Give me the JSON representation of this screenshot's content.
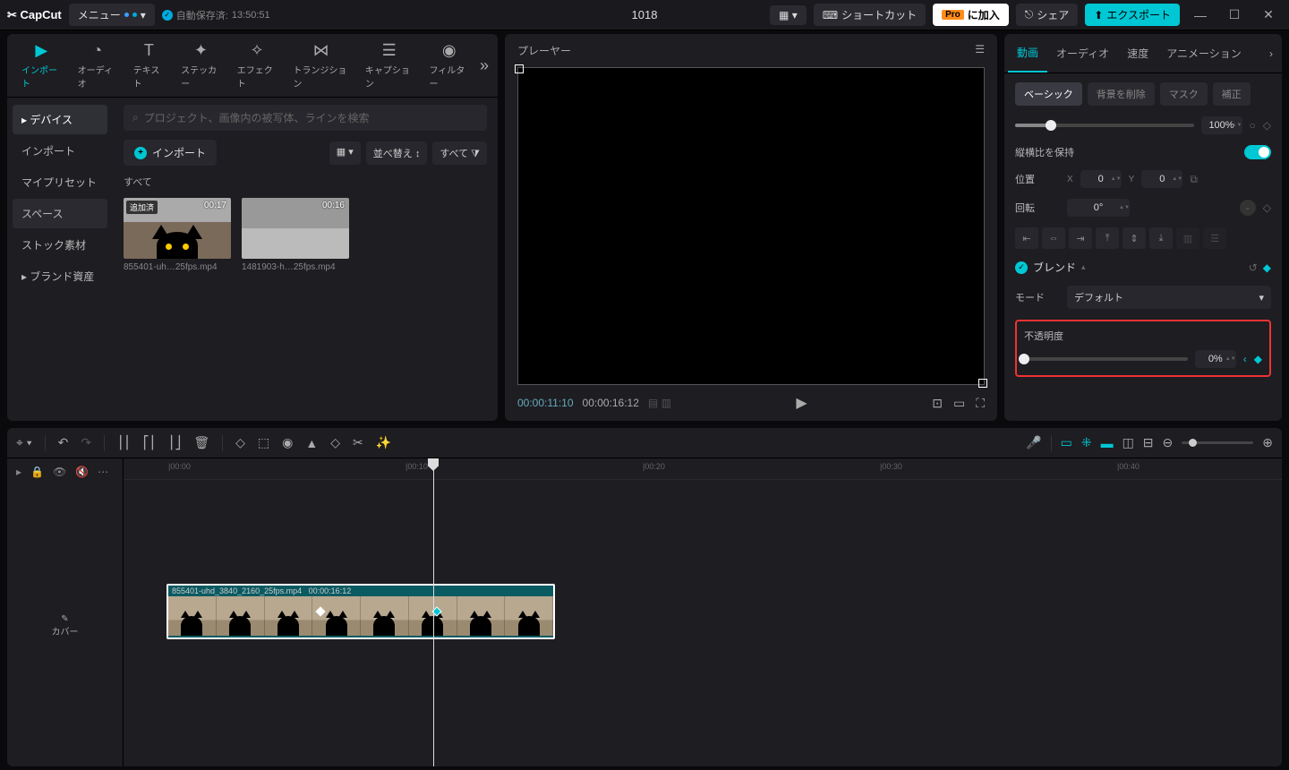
{
  "app": {
    "name": "CapCut"
  },
  "titlebar": {
    "menu": "メニュー",
    "autosave_label": "自動保存済:",
    "autosave_time": "13:50:51",
    "project_title": "1018",
    "shortcut": "ショートカット",
    "pro_badge": "Pro",
    "pro_label": "に加入",
    "share": "シェア",
    "export": "エクスポート"
  },
  "media_tabs": {
    "import": "インポート",
    "audio": "オーディオ",
    "text": "テキスト",
    "sticker": "ステッカー",
    "effect": "エフェクト",
    "transition": "トランジション",
    "caption": "キャプション",
    "filter": "フィルター"
  },
  "side_nav": {
    "device": "デバイス",
    "import": "インポート",
    "my_preset": "マイプリセット",
    "space": "スペース",
    "stock": "ストック素材",
    "brand": "ブランド資産"
  },
  "media": {
    "search_placeholder": "プロジェクト、画像内の被写体、ラインを検索",
    "import_btn": "インポート",
    "sort": "並べ替え",
    "all_filter": "すべて",
    "all_label": "すべて",
    "thumbs": [
      {
        "badge": "追加済",
        "dur": "00:17",
        "name": "855401-uh…25fps.mp4"
      },
      {
        "badge": "",
        "dur": "00:16",
        "name": "1481903-h…25fps.mp4"
      }
    ]
  },
  "player": {
    "title": "プレーヤー",
    "tc_current": "00:00:11:10",
    "tc_total": "00:00:16:12"
  },
  "props": {
    "tabs": {
      "video": "動画",
      "audio": "オーディオ",
      "speed": "速度",
      "anim": "アニメーション"
    },
    "sub": {
      "basic": "ベーシック",
      "bg": "背景を削除",
      "mask": "マスク",
      "correct": "補正"
    },
    "scale_val": "100%",
    "aspect": "縦横比を保持",
    "position": "位置",
    "pos_x": "0",
    "pos_y": "0",
    "rotation": "回転",
    "rotation_val": "0°",
    "blend_title": "ブレンド",
    "mode": "モード",
    "mode_val": "デフォルト",
    "opacity": "不透明度",
    "opacity_val": "0%"
  },
  "timeline": {
    "cover": "カバー",
    "ticks": [
      "00:00",
      "00:10",
      "00:20",
      "00:30",
      "00:40"
    ],
    "clip_name": "855401-uhd_3840_2160_25fps.mp4",
    "clip_dur": "00:00:16:12"
  }
}
